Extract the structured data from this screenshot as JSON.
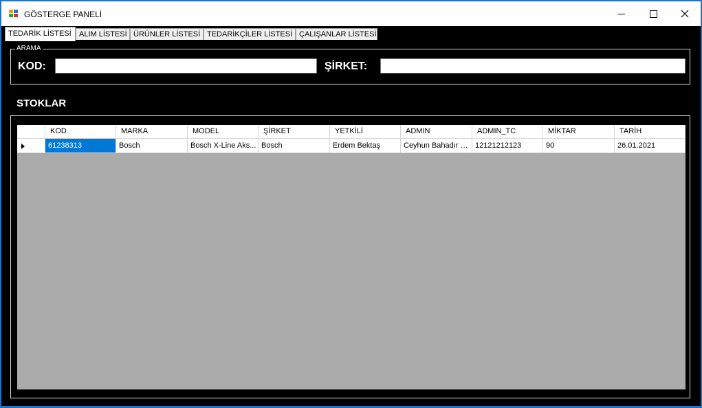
{
  "window": {
    "title": "GÖSTERGE PANELİ"
  },
  "tabs": [
    {
      "label": "TEDARİK LİSTESİ"
    },
    {
      "label": "ALIM LİSTESİ"
    },
    {
      "label": "ÜRÜNLER LİSTESİ"
    },
    {
      "label": "TEDARİKÇİLER LİSTESİ"
    },
    {
      "label": "ÇALIŞANLAR LİSTESİ"
    }
  ],
  "search": {
    "group_label": "ARAMA",
    "kod_label": "KOD:",
    "kod_value": "",
    "sirket_label": "ŞİRKET:",
    "sirket_value": ""
  },
  "stocks": {
    "title": "STOKLAR",
    "columns": [
      "KOD",
      "MARKA",
      "MODEL",
      "ŞİRKET",
      "YETKİLİ",
      "ADMIN",
      "ADMIN_TC",
      "MİKTAR",
      "TARİH"
    ],
    "rows": [
      [
        "61238313",
        "Bosch",
        "Bosch X-Line Aks...",
        "Bosch",
        "Erdem Bektaş",
        "Ceyhun Bahadır Ç...",
        "12121212123",
        "90",
        "26.01.2021"
      ]
    ]
  },
  "colors": {
    "selection": "#0078d7",
    "grid_background": "#ababab",
    "window_background": "#000000"
  }
}
